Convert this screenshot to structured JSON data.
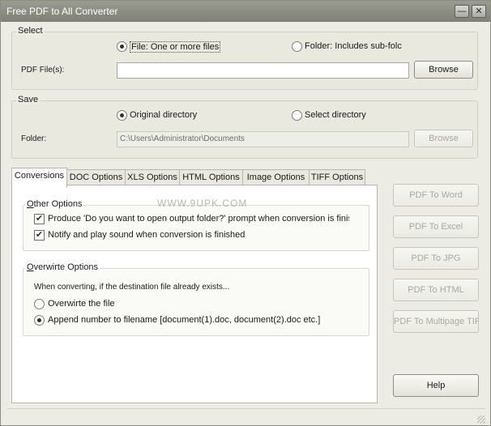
{
  "window": {
    "title": "Free PDF to All Converter",
    "minimize_glyph": "—",
    "close_glyph": "✕"
  },
  "select": {
    "label": "Select",
    "file_radio_label": "File:  One or more files",
    "folder_radio_label": "Folder: Includes sub-folc",
    "selected": "file",
    "pdf_files_label": "PDF File(s):",
    "pdf_files_value": "",
    "browse_label": "Browse"
  },
  "save": {
    "label": "Save",
    "original_radio_label": "Original directory",
    "select_radio_label": "Select directory",
    "selected": "original",
    "folder_label": "Folder:",
    "folder_value": "C:\\Users\\Administrator\\Documents",
    "browse_label": "Browse"
  },
  "tabs": [
    {
      "label": "Conversions",
      "active": true
    },
    {
      "label": "DOC Options",
      "active": false
    },
    {
      "label": "XLS Options",
      "active": false
    },
    {
      "label": "HTML Options",
      "active": false
    },
    {
      "label": "Image Options",
      "active": false
    },
    {
      "label": "TIFF Options",
      "active": false
    }
  ],
  "other_options": {
    "label_first": "O",
    "label_rest": "ther Options",
    "items": [
      {
        "label": "Produce 'Do you want to open output folder?' prompt when conversion is finis",
        "checked": true
      },
      {
        "label": "Notify and play sound when conversion is finished",
        "checked": true
      }
    ]
  },
  "overwrite_options": {
    "label_first": "O",
    "label_rest": "verwirte Options",
    "description": "When converting, if the destination file already exists...",
    "choices": [
      {
        "label": "Overwirte the file",
        "selected": false
      },
      {
        "label": "Append number to filename  [document(1).doc, document(2).doc etc.]",
        "selected": true
      }
    ]
  },
  "actions": {
    "pdf_to_word": "PDF To Word",
    "pdf_to_excel": "PDF To Excel",
    "pdf_to_jpg": "PDF To JPG",
    "pdf_to_html": "PDF To HTML",
    "pdf_to_multipage_tiff": "PDF To Multipage TIFF",
    "help": "Help"
  },
  "watermark": "WWW.9UPK.COM"
}
